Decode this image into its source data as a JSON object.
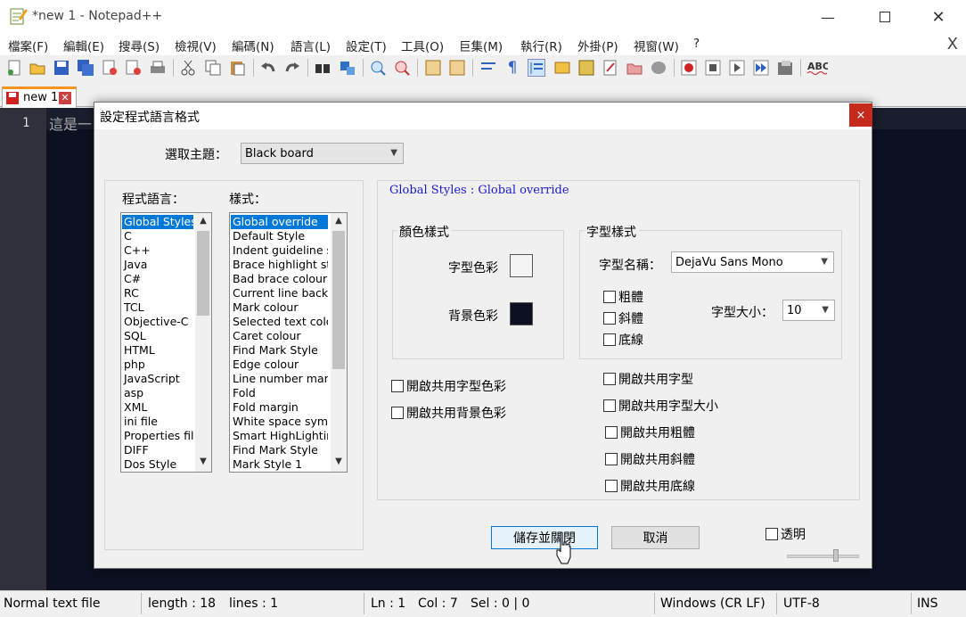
{
  "window": {
    "title": "*new 1 - Notepad++"
  },
  "menu": [
    "檔案(F)",
    "編輯(E)",
    "搜尋(S)",
    "檢視(V)",
    "編碼(N)",
    "語言(L)",
    "設定(T)",
    "工具(O)",
    "巨集(M)",
    "執行(R)",
    "外掛(P)",
    "視窗(W)",
    "?"
  ],
  "menu_close": "X",
  "tab": {
    "label": "new 1"
  },
  "editor": {
    "line_number": "1",
    "text": "這是一"
  },
  "dialog": {
    "title": "設定程式語言格式",
    "close": "×",
    "theme_label": "選取主題：",
    "theme_value": "Black board",
    "language_label": "程式語言：",
    "style_label": "樣式：",
    "languages": [
      "Global Styles",
      "C",
      "C++",
      "Java",
      "C#",
      "RC",
      "TCL",
      "Objective-C",
      "SQL",
      "HTML",
      "php",
      "JavaScript",
      "asp",
      "XML",
      "ini file",
      "Properties file",
      "DIFF",
      "Dos Style"
    ],
    "styles": [
      "Global override",
      "Default Style",
      "Indent guideline style",
      "Brace highlight style",
      "Bad brace colour",
      "Current line background colour",
      "Mark colour",
      "Selected text colour",
      "Caret colour",
      "Find Mark Style",
      "Edge colour",
      "Line number margin",
      "Fold",
      "Fold margin",
      "White space symbol",
      "Smart HighLighting",
      "Find Mark Style",
      "Mark Style 1"
    ],
    "style_header": "Global Styles : Global override",
    "color_group": "顏色樣式",
    "fg_label": "字型色彩",
    "bg_label": "背景色彩",
    "fg_color": "#f4f4f4",
    "bg_color": "#0c1021",
    "font_group": "字型樣式",
    "font_name_label": "字型名稱：",
    "font_name_value": "DejaVu Sans Mono",
    "bold": "粗體",
    "italic": "斜體",
    "underline": "底線",
    "font_size_label": "字型大小：",
    "font_size_value": "10",
    "global_fg": "開啟共用字型色彩",
    "global_bg": "開啟共用背景色彩",
    "global_font": "開啟共用字型",
    "global_size": "開啟共用字型大小",
    "global_bold": "開啟共用粗體",
    "global_italic": "開啟共用斜體",
    "global_underline": "開啟共用底線",
    "save_button": "儲存並關閉",
    "cancel_button": "取消",
    "transparent": "透明"
  },
  "status": {
    "filetype": "Normal text file",
    "length": "length : 18",
    "lines": "lines : 1",
    "ln": "Ln : 1",
    "col": "Col : 7",
    "sel": "Sel : 0 | 0",
    "eol": "Windows (CR LF)",
    "encoding": "UTF-8",
    "mode": "INS"
  }
}
